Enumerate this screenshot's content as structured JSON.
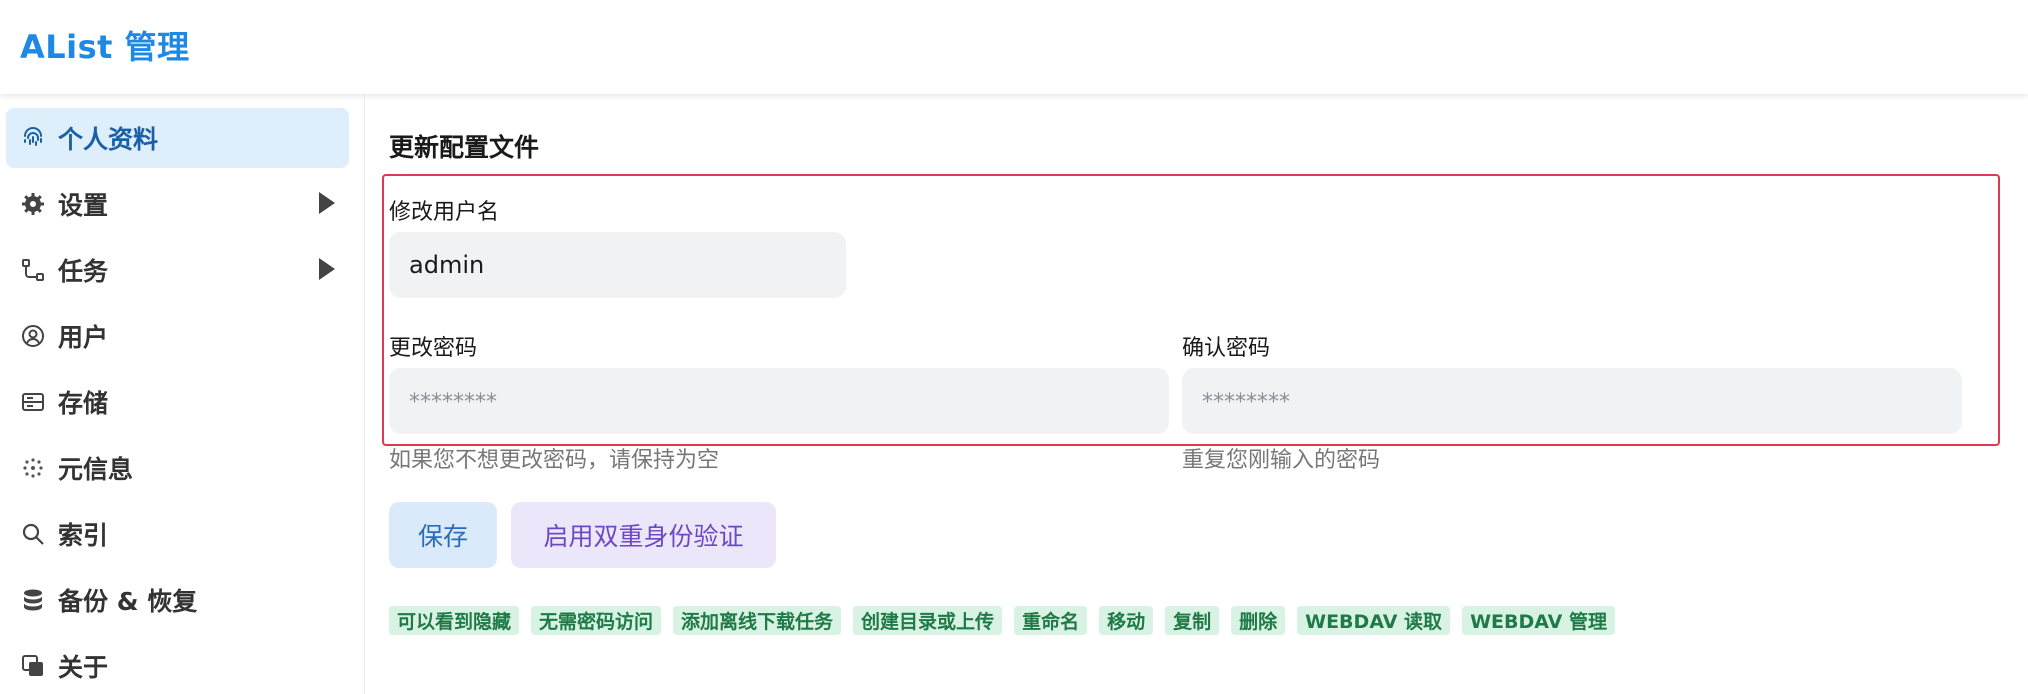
{
  "app": {
    "title": "AList 管理"
  },
  "sidebar": {
    "items": [
      {
        "label": "个人资料",
        "icon": "fingerprint-icon",
        "active": true,
        "has_submenu": false
      },
      {
        "label": "设置",
        "icon": "gear-icon",
        "active": false,
        "has_submenu": true
      },
      {
        "label": "任务",
        "icon": "workflow-icon",
        "active": false,
        "has_submenu": true
      },
      {
        "label": "用户",
        "icon": "user-circle-icon",
        "active": false,
        "has_submenu": false
      },
      {
        "label": "存储",
        "icon": "storage-icon",
        "active": false,
        "has_submenu": false
      },
      {
        "label": "元信息",
        "icon": "metadata-icon",
        "active": false,
        "has_submenu": false
      },
      {
        "label": "索引",
        "icon": "search-icon",
        "active": false,
        "has_submenu": false
      },
      {
        "label": "备份 & 恢复",
        "icon": "database-icon",
        "active": false,
        "has_submenu": false
      },
      {
        "label": "关于",
        "icon": "copy-icon",
        "active": false,
        "has_submenu": false
      }
    ]
  },
  "main": {
    "section_title": "更新配置文件",
    "username": {
      "label": "修改用户名",
      "value": "admin"
    },
    "password": {
      "label": "更改密码",
      "placeholder": "********",
      "help": "如果您不想更改密码，请保持为空"
    },
    "confirm": {
      "label": "确认密码",
      "placeholder": "********",
      "help": "重复您刚输入的密码"
    },
    "buttons": {
      "save": "保存",
      "enable_2fa": "启用双重身份验证"
    },
    "permissions": [
      "可以看到隐藏",
      "无需密码访问",
      "添加离线下载任务",
      "创建目录或上传",
      "重命名",
      "移动",
      "复制",
      "删除",
      "WEBDAV 读取",
      "WEBDAV 管理"
    ]
  },
  "colors": {
    "accent": "#1e88e5",
    "active_bg": "#deeefb",
    "highlight_border": "#e0394f",
    "badge_bg": "#d8f3e3",
    "badge_text": "#1f7a47"
  }
}
